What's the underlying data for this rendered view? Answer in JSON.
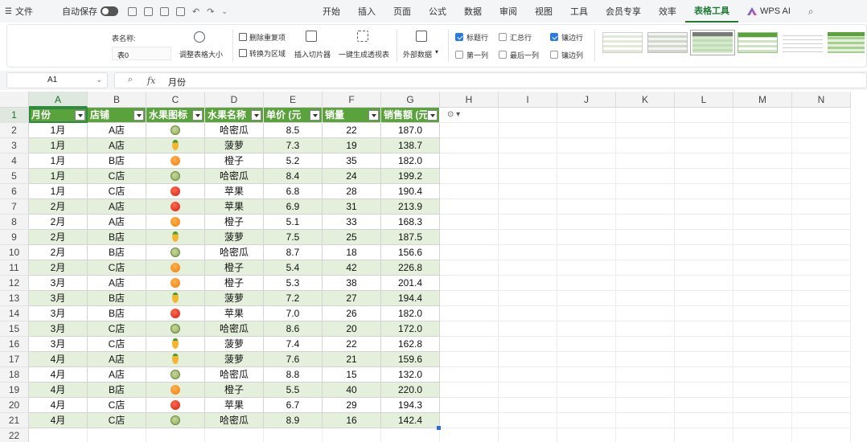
{
  "menubar": {
    "file_label": "文件",
    "autosave_label": "自动保存",
    "tabs": [
      "开始",
      "插入",
      "页面",
      "公式",
      "数据",
      "审阅",
      "视图",
      "工具",
      "会员专享",
      "效率",
      "表格工具"
    ],
    "active_tab": "表格工具",
    "wps_ai_label": "WPS AI"
  },
  "ribbon": {
    "table_name_label": "表名称:",
    "table_name_value": "表0",
    "resize_table_label": "调整表格大小",
    "remove_duplicates_label": "删除重复项",
    "convert_to_range_label": "转换为区域",
    "insert_slicer_label": "插入切片器",
    "pivot_label": "一键生成透视表",
    "external_data_label": "外部数据",
    "options": [
      {
        "label": "标题行",
        "checked": true
      },
      {
        "label": "汇总行",
        "checked": false
      },
      {
        "label": "镶边行",
        "checked": true
      },
      {
        "label": "第一列",
        "checked": false
      },
      {
        "label": "最后一列",
        "checked": false
      },
      {
        "label": "镶边列",
        "checked": false
      }
    ]
  },
  "formula_bar": {
    "cell_ref": "A1",
    "fx_label": "fx",
    "content": "月份"
  },
  "columns": [
    "A",
    "B",
    "C",
    "D",
    "E",
    "F",
    "G",
    "H",
    "I",
    "J",
    "K",
    "L",
    "M",
    "N"
  ],
  "row_numbers": [
    "1",
    "2",
    "3",
    "4",
    "5",
    "6",
    "7",
    "8",
    "9",
    "10",
    "11",
    "12",
    "13",
    "14",
    "15",
    "16",
    "17",
    "18",
    "19",
    "20",
    "21",
    "22"
  ],
  "table": {
    "headers": [
      "月份",
      "店铺",
      "水果图标",
      "水果名称",
      "单价 (元",
      "销量",
      "销售额 (元"
    ],
    "rows": [
      {
        "month": "1月",
        "store": "A店",
        "icon": "melon",
        "fruit": "哈密瓜",
        "price": "8.5",
        "qty": "22",
        "sales": "187.0"
      },
      {
        "month": "1月",
        "store": "A店",
        "icon": "pine",
        "fruit": "菠萝",
        "price": "7.3",
        "qty": "19",
        "sales": "138.7"
      },
      {
        "month": "1月",
        "store": "B店",
        "icon": "orange",
        "fruit": "橙子",
        "price": "5.2",
        "qty": "35",
        "sales": "182.0"
      },
      {
        "month": "1月",
        "store": "C店",
        "icon": "melon",
        "fruit": "哈密瓜",
        "price": "8.4",
        "qty": "24",
        "sales": "199.2"
      },
      {
        "month": "1月",
        "store": "C店",
        "icon": "apple",
        "fruit": "苹果",
        "price": "6.8",
        "qty": "28",
        "sales": "190.4"
      },
      {
        "month": "2月",
        "store": "A店",
        "icon": "apple",
        "fruit": "苹果",
        "price": "6.9",
        "qty": "31",
        "sales": "213.9"
      },
      {
        "month": "2月",
        "store": "A店",
        "icon": "orange",
        "fruit": "橙子",
        "price": "5.1",
        "qty": "33",
        "sales": "168.3"
      },
      {
        "month": "2月",
        "store": "B店",
        "icon": "pine",
        "fruit": "菠萝",
        "price": "7.5",
        "qty": "25",
        "sales": "187.5"
      },
      {
        "month": "2月",
        "store": "B店",
        "icon": "melon",
        "fruit": "哈密瓜",
        "price": "8.7",
        "qty": "18",
        "sales": "156.6"
      },
      {
        "month": "2月",
        "store": "C店",
        "icon": "orange",
        "fruit": "橙子",
        "price": "5.4",
        "qty": "42",
        "sales": "226.8"
      },
      {
        "month": "3月",
        "store": "A店",
        "icon": "orange",
        "fruit": "橙子",
        "price": "5.3",
        "qty": "38",
        "sales": "201.4"
      },
      {
        "month": "3月",
        "store": "B店",
        "icon": "pine",
        "fruit": "菠萝",
        "price": "7.2",
        "qty": "27",
        "sales": "194.4"
      },
      {
        "month": "3月",
        "store": "B店",
        "icon": "apple",
        "fruit": "苹果",
        "price": "7.0",
        "qty": "26",
        "sales": "182.0"
      },
      {
        "month": "3月",
        "store": "C店",
        "icon": "melon",
        "fruit": "哈密瓜",
        "price": "8.6",
        "qty": "20",
        "sales": "172.0"
      },
      {
        "month": "3月",
        "store": "C店",
        "icon": "pine",
        "fruit": "菠萝",
        "price": "7.4",
        "qty": "22",
        "sales": "162.8"
      },
      {
        "month": "4月",
        "store": "A店",
        "icon": "pine",
        "fruit": "菠萝",
        "price": "7.6",
        "qty": "21",
        "sales": "159.6"
      },
      {
        "month": "4月",
        "store": "A店",
        "icon": "melon",
        "fruit": "哈密瓜",
        "price": "8.8",
        "qty": "15",
        "sales": "132.0"
      },
      {
        "month": "4月",
        "store": "B店",
        "icon": "orange",
        "fruit": "橙子",
        "price": "5.5",
        "qty": "40",
        "sales": "220.0"
      },
      {
        "month": "4月",
        "store": "C店",
        "icon": "apple",
        "fruit": "苹果",
        "price": "6.7",
        "qty": "29",
        "sales": "194.3"
      },
      {
        "month": "4月",
        "store": "C店",
        "icon": "melon",
        "fruit": "哈密瓜",
        "price": "8.9",
        "qty": "16",
        "sales": "142.4"
      }
    ]
  },
  "colors": {
    "header_green": "#5aa23c",
    "band_green": "#e4f0dc",
    "accent": "#1e7b35"
  }
}
